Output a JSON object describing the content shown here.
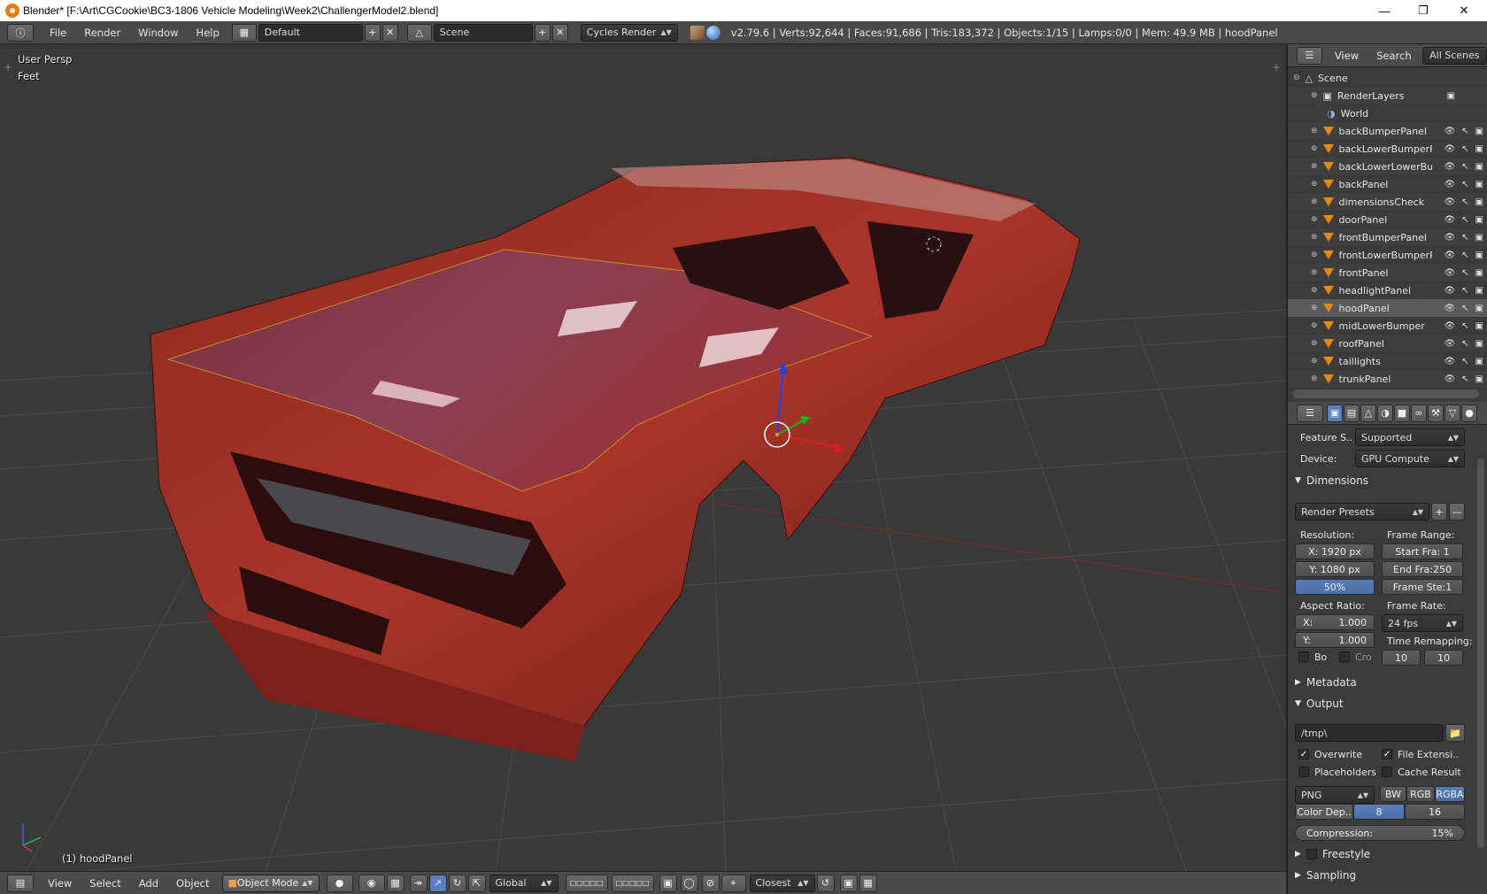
{
  "window": {
    "title": "Blender* [F:\\Art\\CGCookie\\BC3-1806 Vehicle Modeling\\Week2\\ChallengerModel2.blend]"
  },
  "infobar": {
    "menus": [
      "File",
      "Render",
      "Window",
      "Help"
    ],
    "layout": "Default",
    "scene": "Scene",
    "engine": "Cycles Render",
    "stats": "v2.79.6 | Verts:92,644 | Faces:91,686 | Tris:183,372 | Objects:1/15 | Lamps:0/0 | Mem: 49.9 MB | hoodPanel"
  },
  "viewport": {
    "view": "User Persp",
    "units": "Feet",
    "object": "(1) hoodPanel"
  },
  "bottombar": {
    "menus": [
      "View",
      "Select",
      "Add",
      "Object"
    ],
    "mode": "Object Mode",
    "orientation": "Global",
    "snap": "Closest"
  },
  "outliner": {
    "tabs": [
      "View",
      "Search",
      "All Scenes"
    ],
    "scene": "Scene",
    "render_layers": "RenderLayers",
    "world": "World",
    "objects": [
      "backBumperPanel",
      "backLowerBumperPa",
      "backLowerLowerBur",
      "backPanel",
      "dimensionsCheck",
      "doorPanel",
      "frontBumperPanel",
      "frontLowerBumperPa",
      "frontPanel",
      "headlightPanel",
      "hoodPanel",
      "midLowerBumper",
      "roofPanel",
      "taillights",
      "trunkPanel"
    ],
    "selected": "hoodPanel"
  },
  "props": {
    "feature_set_label": "Feature S..",
    "feature_set": "Supported",
    "device_label": "Device:",
    "device": "GPU Compute",
    "dimensions": "Dimensions",
    "render_presets": "Render Presets",
    "resolution_label": "Resolution:",
    "res_x": "X:  1920 px",
    "res_y": "Y:  1080 px",
    "res_pct": "50%",
    "frame_range_label": "Frame Range:",
    "start": "Start Fra:  1",
    "end": "End Fra:250",
    "step": "Frame Ste:1",
    "aspect_label": "Aspect Ratio:",
    "asp_x": "X:",
    "asp_x_val": "1.000",
    "asp_y": "Y:",
    "asp_y_val": "1.000",
    "frame_rate_label": "Frame Rate:",
    "fps": "24 fps",
    "time_remap_label": "Time Remapping:",
    "border": "Bo",
    "crop": "Cro",
    "remap_old": "10",
    "remap_new": "10",
    "metadata": "Metadata",
    "output": "Output",
    "path": "/tmp\\",
    "overwrite": "Overwrite",
    "file_ext": "File Extensi..",
    "placeholders": "Placeholders",
    "cache": "Cache Result",
    "format": "PNG",
    "bw": "BW",
    "rgb": "RGB",
    "rgba": "RGBA",
    "color_depth_label": "Color Dep..",
    "depth_8": "8",
    "depth_16": "16",
    "compression_label": "Compression:",
    "compression": "15%",
    "freestyle": "Freestyle",
    "sampling": "Sampling"
  }
}
